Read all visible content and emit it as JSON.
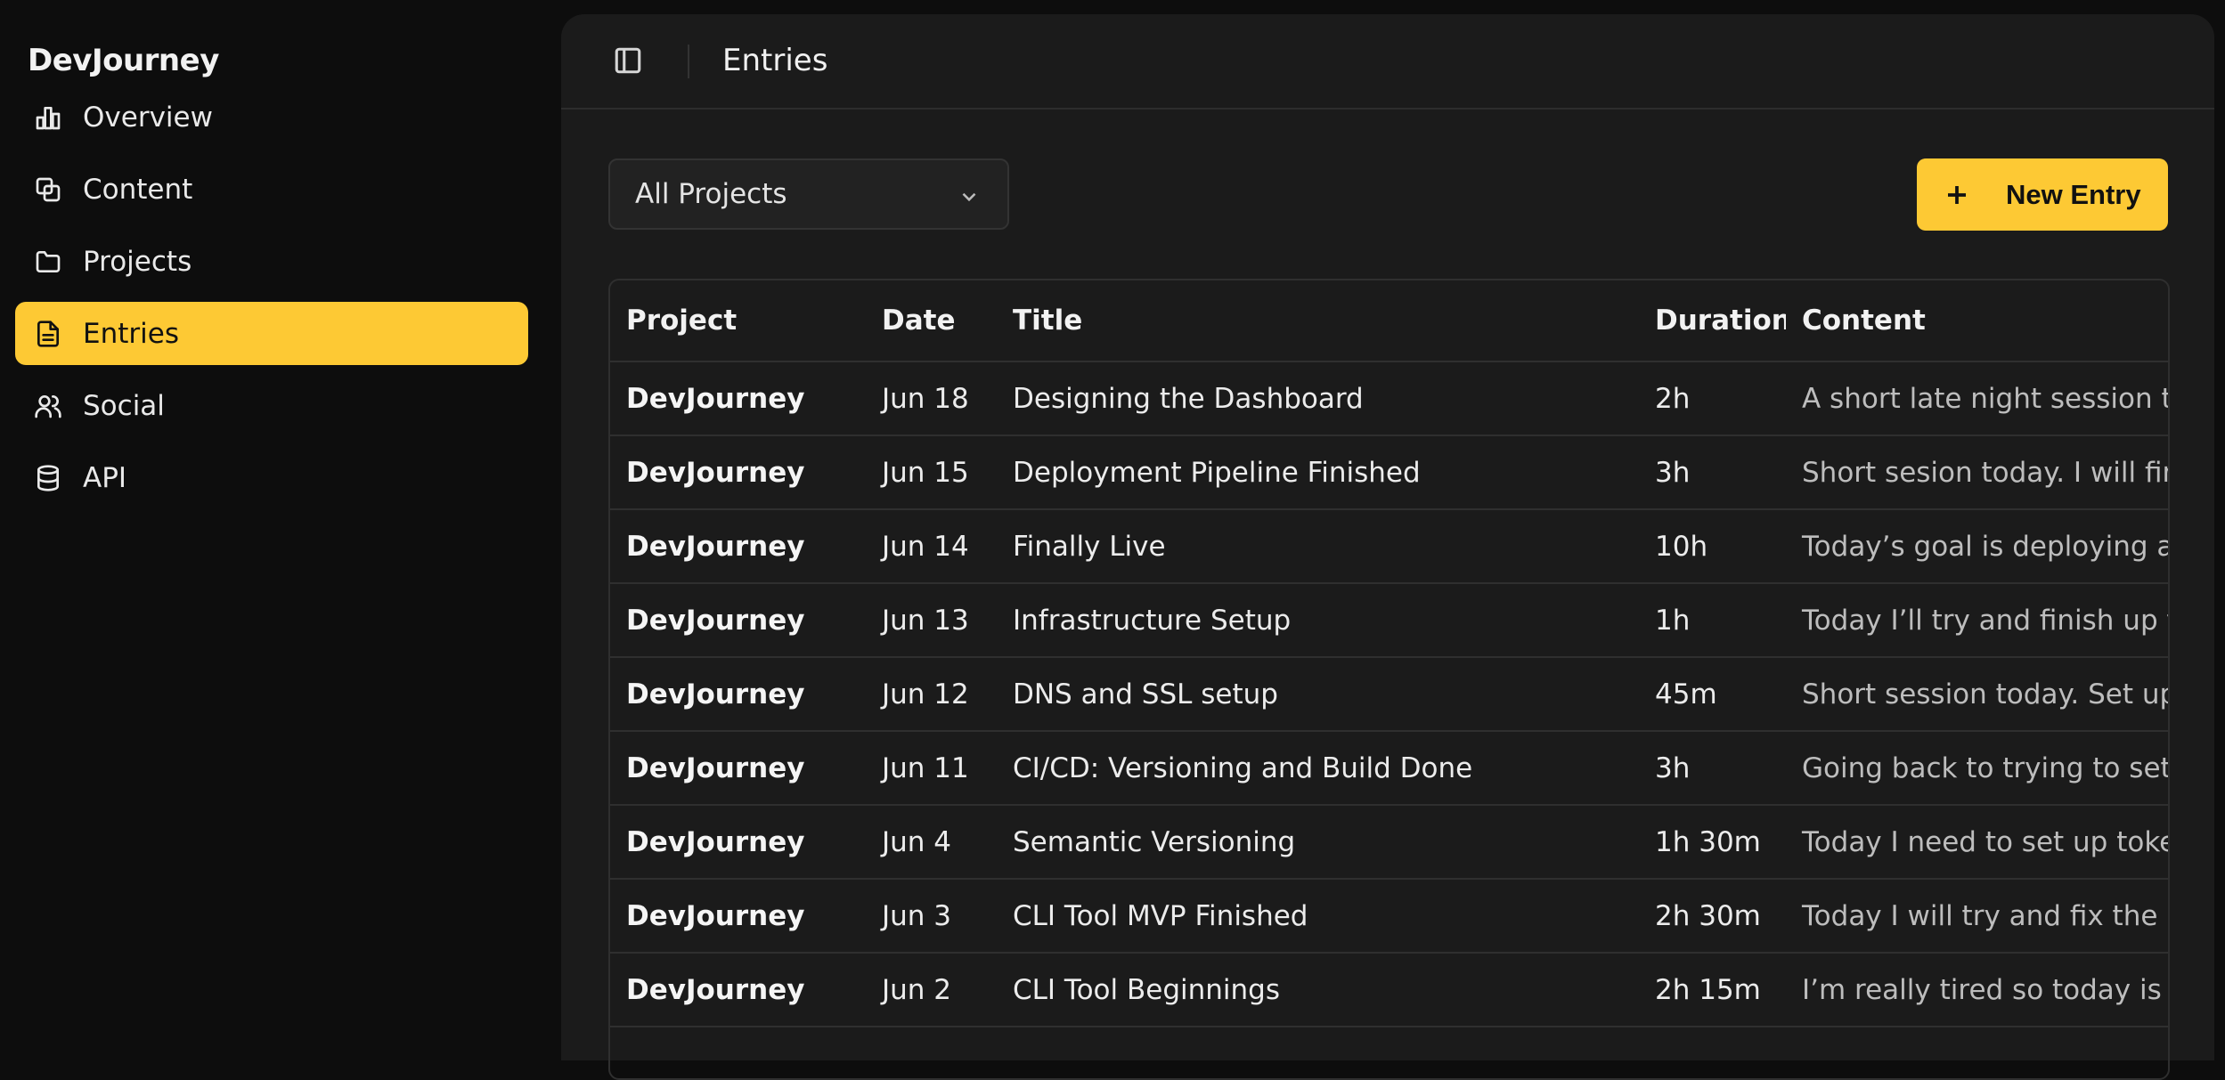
{
  "app": {
    "name": "DevJourney"
  },
  "sidebar": {
    "items": [
      {
        "label": "Overview",
        "icon": "bar-chart-icon",
        "active": false
      },
      {
        "label": "Content",
        "icon": "copy-icon",
        "active": false
      },
      {
        "label": "Projects",
        "icon": "folder-icon",
        "active": false
      },
      {
        "label": "Entries",
        "icon": "file-text-icon",
        "active": true
      },
      {
        "label": "Social",
        "icon": "users-icon",
        "active": false
      },
      {
        "label": "API",
        "icon": "database-icon",
        "active": false
      }
    ]
  },
  "header": {
    "title": "Entries"
  },
  "filter": {
    "selected": "All Projects"
  },
  "toolbar": {
    "new_entry_label": "New Entry"
  },
  "colors": {
    "accent": "#fdc934",
    "background": "#0d0d0d",
    "panel": "#1b1b1b"
  },
  "table": {
    "columns": [
      "Project",
      "Date",
      "Title",
      "Duration",
      "Content"
    ],
    "rows": [
      {
        "project": "DevJourney",
        "date": "Jun 18",
        "title": "Designing the Dashboard",
        "duration": "2h",
        "content": "A short late night session t"
      },
      {
        "project": "DevJourney",
        "date": "Jun 15",
        "title": "Deployment Pipeline Finished",
        "duration": "3h",
        "content": "Short sesion today. I will fin"
      },
      {
        "project": "DevJourney",
        "date": "Jun 14",
        "title": "Finally Live",
        "duration": "10h",
        "content": "Today’s goal is deploying a"
      },
      {
        "project": "DevJourney",
        "date": "Jun 13",
        "title": "Infrastructure Setup",
        "duration": "1h",
        "content": "Today I’ll try and finish up t"
      },
      {
        "project": "DevJourney",
        "date": "Jun 12",
        "title": "DNS and SSL setup",
        "duration": "45m",
        "content": "Short session today. Set up"
      },
      {
        "project": "DevJourney",
        "date": "Jun 11",
        "title": "CI/CD: Versioning and Build Done",
        "duration": "3h",
        "content": "Going back to trying to set"
      },
      {
        "project": "DevJourney",
        "date": "Jun 4",
        "title": "Semantic Versioning",
        "duration": "1h 30m",
        "content": "Today I need to set up toke"
      },
      {
        "project": "DevJourney",
        "date": "Jun 3",
        "title": "CLI Tool MVP Finished",
        "duration": "2h 30m",
        "content": "Today I will try and fix the n"
      },
      {
        "project": "DevJourney",
        "date": "Jun 2",
        "title": "CLI Tool Beginnings",
        "duration": "2h 15m",
        "content": "I’m really tired so today is g"
      }
    ]
  }
}
